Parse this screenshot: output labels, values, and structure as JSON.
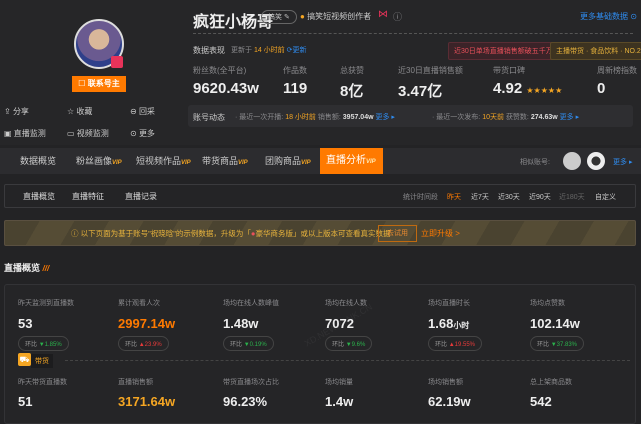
{
  "profile": {
    "name": "疯狂小杨哥",
    "tag": "搞笑",
    "role": "搞笑短视频创作者",
    "contact": "联系号主",
    "more_basic": "更多基础数据 ⊙"
  },
  "actions": [
    "分享",
    "收藏",
    "回采",
    "直播监测",
    "视频监测",
    "更多"
  ],
  "performance": {
    "label": "数据表现",
    "updated_prefix": "更新于",
    "updated_time": "14 小时前",
    "refresh": "更新",
    "badges": [
      "近30日单场直播销售额破五千万",
      "主播带货 · 食品饮料 · NO.2"
    ],
    "stats": [
      {
        "label": "粉丝数(全平台)",
        "value": "9620.43w"
      },
      {
        "label": "作品数",
        "value": "119"
      },
      {
        "label": "总获赞",
        "value": "8亿"
      },
      {
        "label": "近30日直播销售额",
        "value": "3.47亿"
      },
      {
        "label": "带货口碑",
        "value": "4.92",
        "stars": "★★★★★"
      },
      {
        "label": "周新榜指数",
        "value": "0"
      }
    ]
  },
  "dynamics": {
    "label": "账号动态",
    "live_prefix": "· 最近一次开播:",
    "live_time": "18 小时前",
    "sales_label": "销售额:",
    "sales": "3957.04w",
    "more": "更多 ▸",
    "post_prefix": "· 最近一次发布:",
    "post_time": "10天前",
    "likes_label": "获赞数:",
    "likes": "274.63w"
  },
  "tabs": [
    {
      "label": "数据概览",
      "vip": ""
    },
    {
      "label": "粉丝画像",
      "vip": "VIP"
    },
    {
      "label": "短视频作品",
      "vip": "VIP"
    },
    {
      "label": "带货商品",
      "vip": "VIP"
    },
    {
      "label": "团购商品",
      "vip": "VIP"
    },
    {
      "label": "直播分析",
      "vip": "VIP"
    }
  ],
  "similar": {
    "label": "相似账号:",
    "more": "更多 ▸"
  },
  "subtabs": [
    "直播概览",
    "直播特征",
    "直播记录"
  ],
  "periods": {
    "label": "统计时间段",
    "options": [
      "昨天",
      "近7天",
      "近30天",
      "近90天",
      "近180天",
      "自定义"
    ]
  },
  "banner": {
    "text1": "ⓘ 以下页面为基于账号\"祝晓晗\"的示例数据，升级为「",
    "plan": "豪华商务版",
    "text2": "」或以上版本可查看真实数据",
    "try": "去试用",
    "upgrade": "立即升级 >"
  },
  "section_title": "直播概览",
  "metrics": [
    {
      "label": "昨天监测到直播数",
      "value": "53",
      "cmp": "环比",
      "dir": "▼",
      "pct": "1.85%"
    },
    {
      "label": "累计观看人次",
      "value": "2997.14w",
      "cmp": "环比",
      "dir": "▲",
      "pct": "23.9%"
    },
    {
      "label": "场均在线人数峰值",
      "value": "1.48w",
      "cmp": "环比",
      "dir": "▼",
      "pct": "0.19%"
    },
    {
      "label": "场均在线人数",
      "value": "7072",
      "cmp": "环比",
      "dir": "▼",
      "pct": "9.6%"
    },
    {
      "label": "场均直播时长",
      "value": "1.68",
      "unit": "小时",
      "cmp": "环比",
      "dir": "▲",
      "pct": "19.55%"
    },
    {
      "label": "场均点赞数",
      "value": "102.14w",
      "cmp": "环比",
      "dir": "▼",
      "pct": "37.83%"
    }
  ],
  "goods_label": "带货",
  "goods_metrics": [
    {
      "label": "昨天带货直播数",
      "value": "51"
    },
    {
      "label": "直播销售额",
      "value": "3171.64w"
    },
    {
      "label": "带货直播场次占比",
      "value": "96.23%"
    },
    {
      "label": "场均销量",
      "value": "1.4w"
    },
    {
      "label": "场均销售额",
      "value": "62.19w"
    },
    {
      "label": "总上架商品数",
      "value": "542"
    }
  ]
}
